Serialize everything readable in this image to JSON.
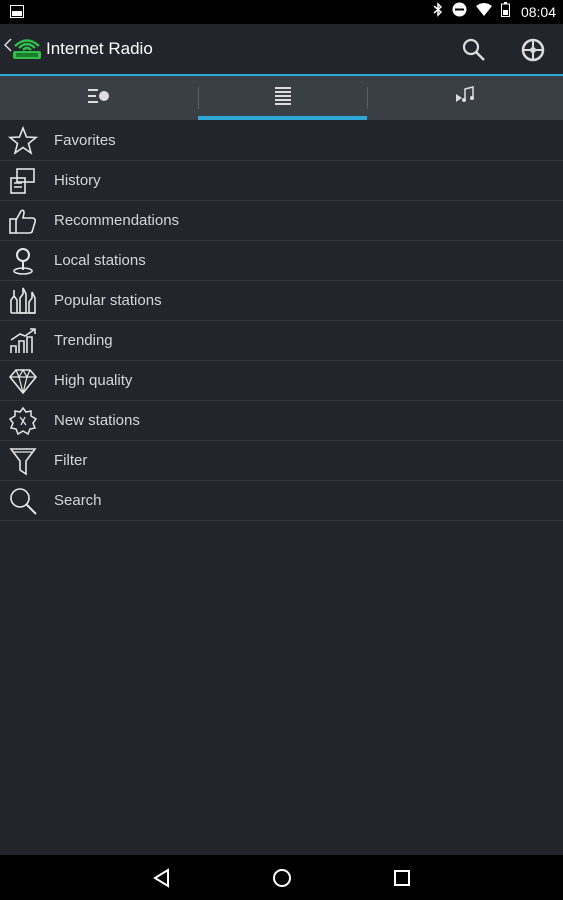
{
  "status_bar": {
    "time": "08:04",
    "icons": [
      "screenshot-icon",
      "bluetooth-icon",
      "do-not-disturb-icon",
      "wifi-icon",
      "battery-icon"
    ]
  },
  "app_bar": {
    "title": "Internet Radio",
    "logo": "radio-logo-icon",
    "actions": [
      "search-icon",
      "settings-icon"
    ]
  },
  "tabs": [
    {
      "icon": "queue-list-icon",
      "selected": false
    },
    {
      "icon": "list-lines-icon",
      "selected": true
    },
    {
      "icon": "play-music-icon",
      "selected": false
    }
  ],
  "menu": {
    "items": [
      {
        "label": "Favorites",
        "icon": "star-icon"
      },
      {
        "label": "History",
        "icon": "history-icon"
      },
      {
        "label": "Recommendations",
        "icon": "thumbs-up-icon"
      },
      {
        "label": "Local stations",
        "icon": "location-pin-icon"
      },
      {
        "label": "Popular stations",
        "icon": "popular-bottles-icon"
      },
      {
        "label": "Trending",
        "icon": "trending-chart-icon"
      },
      {
        "label": "High quality",
        "icon": "diamond-icon"
      },
      {
        "label": "New stations",
        "icon": "new-badge-icon"
      },
      {
        "label": "Filter",
        "icon": "filter-icon"
      },
      {
        "label": "Search",
        "icon": "search-icon"
      }
    ]
  },
  "nav_bar": [
    "back-icon",
    "home-icon",
    "recents-icon"
  ],
  "colors": {
    "background": "#22252c",
    "accent": "#2ea8d6",
    "tab_bar": "#3a3e45",
    "text": "#d5d6d8"
  }
}
